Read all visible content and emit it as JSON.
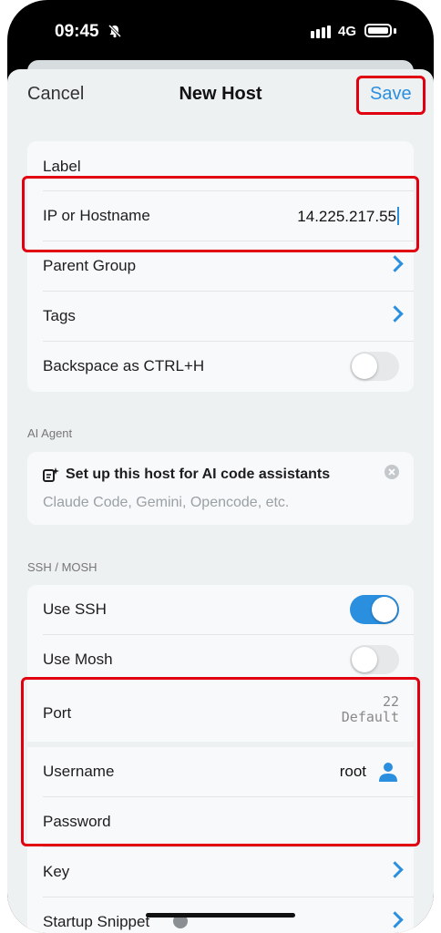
{
  "status": {
    "time": "09:45",
    "network": "4G"
  },
  "nav": {
    "cancel": "Cancel",
    "title": "New Host",
    "save": "Save"
  },
  "general": {
    "label": "Label",
    "ip_label": "IP or Hostname",
    "ip_value": "14.225.217.55",
    "parent_group": "Parent Group",
    "tags": "Tags",
    "backspace": "Backspace as CTRL+H",
    "backspace_on": false
  },
  "ai": {
    "header": "AI Agent",
    "title": "Set up this host for AI code assistants",
    "subtitle": "Claude Code, Gemini, Opencode, etc."
  },
  "ssh": {
    "header": "SSH / MOSH",
    "use_ssh": "Use SSH",
    "use_ssh_on": true,
    "use_mosh": "Use Mosh",
    "use_mosh_on": false,
    "port_label": "Port",
    "port_value": "22",
    "port_default": "Default",
    "username_label": "Username",
    "username_value": "root",
    "password_label": "Password",
    "key_label": "Key",
    "startup_snippet": "Startup Snippet"
  },
  "icons": {
    "bell": "bell-slash-icon",
    "signal": "signal-bars-icon",
    "battery": "battery-icon",
    "chevron": "chevron-right-icon",
    "sparkle": "ai-sparkle-icon",
    "close": "close-circle-icon",
    "user": "user-icon",
    "info": "info-icon"
  },
  "colors": {
    "accent": "#2b8fe0",
    "highlight": "#e0000f",
    "background": "#eef1f2",
    "card": "#f8f9fa"
  }
}
